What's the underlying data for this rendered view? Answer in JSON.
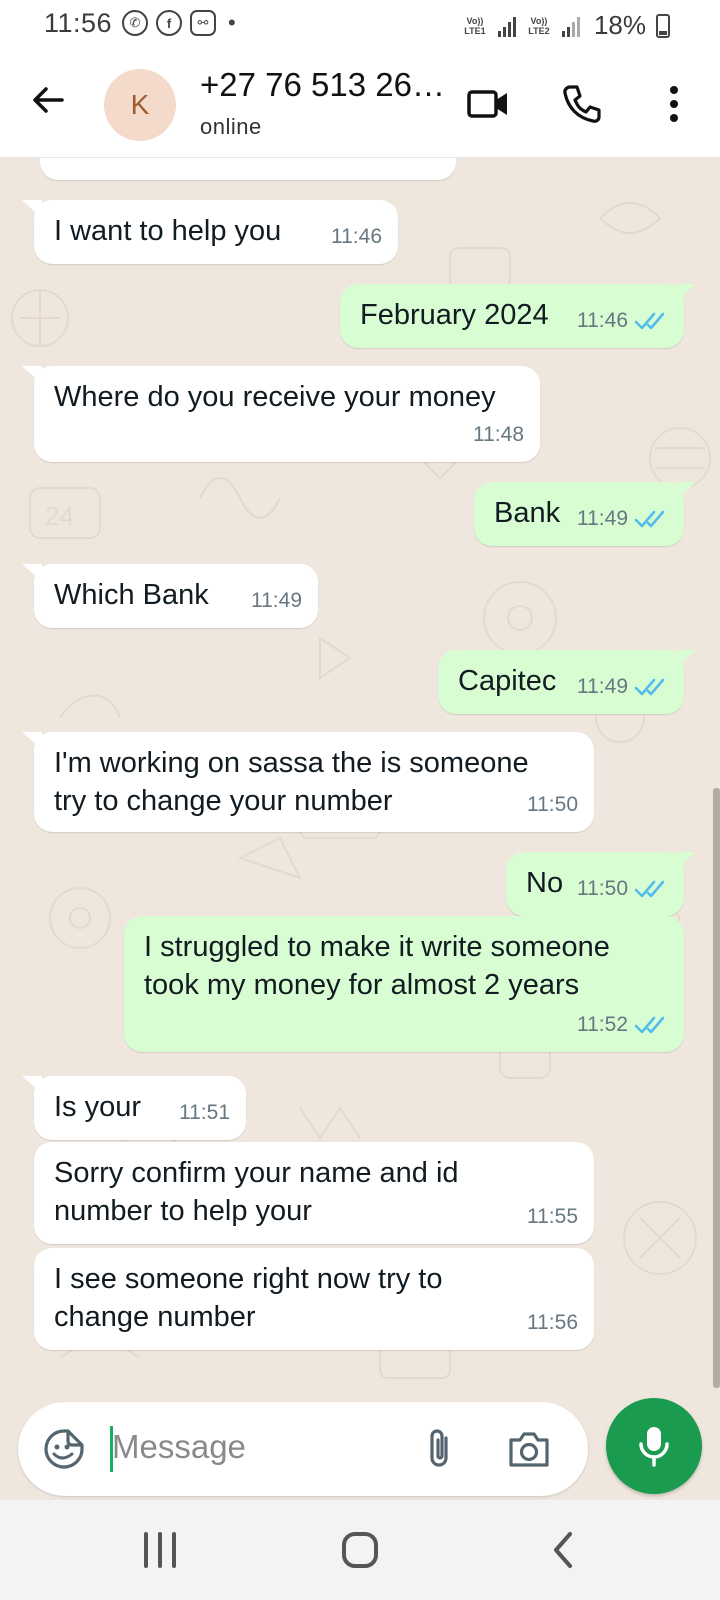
{
  "status_bar": {
    "time": "11:56",
    "notification_icons": [
      "whatsapp-icon",
      "facebook-icon",
      "messenger-icon"
    ],
    "sim1_label": "Vo)) LTE1",
    "sim2_label": "Vo)) LTE2",
    "battery": "18%",
    "battery_level": 0.18
  },
  "header": {
    "avatar_letter": "K",
    "contact_name": "+27 76 513 26…",
    "status": "online",
    "icons": [
      "back-arrow-icon",
      "video-call-icon",
      "phone-call-icon",
      "more-vert-icon"
    ]
  },
  "messages": [
    {
      "dir": "in",
      "text": "I want to help you",
      "time": "11:46"
    },
    {
      "dir": "out",
      "text": "February 2024",
      "time": "11:46",
      "status": "read"
    },
    {
      "dir": "in",
      "text": "Where do you receive your money",
      "time": "11:48"
    },
    {
      "dir": "out",
      "text": "Bank",
      "time": "11:49",
      "status": "read"
    },
    {
      "dir": "in",
      "text": "Which Bank",
      "time": "11:49"
    },
    {
      "dir": "out",
      "text": "Capitec",
      "time": "11:49",
      "status": "read"
    },
    {
      "dir": "in",
      "text": "I'm working on sassa the is someone\ntry to change your number",
      "time": "11:50"
    },
    {
      "dir": "out",
      "text": "No",
      "time": "11:50",
      "status": "read"
    },
    {
      "dir": "out",
      "text": "I struggled to make it write someone\ntook my money for almost 2 years",
      "time": "11:52",
      "status": "read"
    },
    {
      "dir": "in",
      "text": "Is your",
      "time": "11:51"
    },
    {
      "dir": "in",
      "text": "Sorry confirm your name and id\nnumber to help your",
      "time": "11:55"
    },
    {
      "dir": "in",
      "text": "I see someone right now try to\nchange number",
      "time": "11:56"
    }
  ],
  "input": {
    "placeholder": "Message",
    "icons": [
      "emoji-sticker-icon",
      "attach-clip-icon",
      "camera-icon",
      "mic-icon"
    ]
  },
  "nav_bar": {
    "icons": [
      "recent-apps-icon",
      "home-icon",
      "back-icon"
    ]
  },
  "colors": {
    "chat_background": "#efe7dd",
    "outgoing_bubble": "#d9fdd3",
    "incoming_bubble": "#ffffff",
    "read_ticks": "#53bdeb",
    "accent_green": "#1b9b4f"
  }
}
